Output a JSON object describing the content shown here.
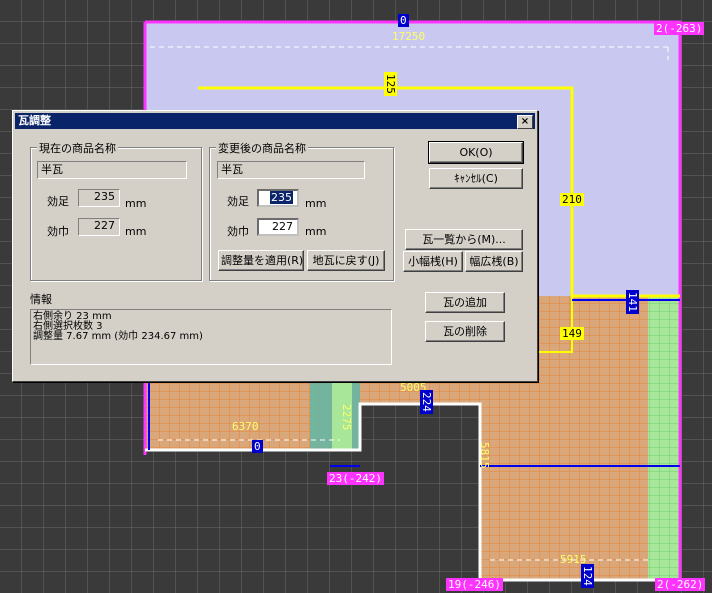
{
  "canvas": {
    "labels": {
      "top_center": "0",
      "top_right": "2(-263)",
      "dim_top": "17250",
      "dim_125": "125",
      "dim_210": "210",
      "dim_149": "149",
      "dim_141": "141",
      "dim_5005": "5005",
      "dim_224": "224",
      "dim_6370": "6370",
      "dim_bottom_left_zero": "0",
      "dim_2275": "2275",
      "pt_23": "23(-242)",
      "dim_5915": "5915",
      "dim_124": "124",
      "pt_19": "19(-246)",
      "pt_bottom_right": "2(-262)",
      "dim_5815": "5815"
    }
  },
  "dialog": {
    "title": "瓦調整",
    "close_glyph": "×",
    "current": {
      "group_title": "現在の商品名称",
      "product_name": "半瓦",
      "kouashi_label": "効足",
      "kouashi_value": "235",
      "kouhaba_label": "効巾",
      "kouhaba_value": "227",
      "unit": "mm"
    },
    "changed": {
      "group_title": "変更後の商品名称",
      "product_name": "半瓦",
      "kouashi_label": "効足",
      "kouashi_value": "235",
      "kouhaba_label": "効巾",
      "kouhaba_value": "227",
      "unit": "mm"
    },
    "buttons": {
      "ok": "OK(O)",
      "cancel": "ｷｬﾝｾﾙ(C)",
      "from_list": "瓦一覧から(M)...",
      "small_width": "小幅桟(H)",
      "wide_width": "幅広桟(B)",
      "apply_adjust": "調整量を適用(R)",
      "restore_base": "地瓦に戻す(J)",
      "add_tile": "瓦の追加",
      "delete_tile": "瓦の削除"
    },
    "info": {
      "label": "情報",
      "lines": [
        "右側余り 23 mm",
        "右側選択枚数 3",
        "調整量 7.67 mm (効巾 234.67 mm)"
      ]
    }
  }
}
